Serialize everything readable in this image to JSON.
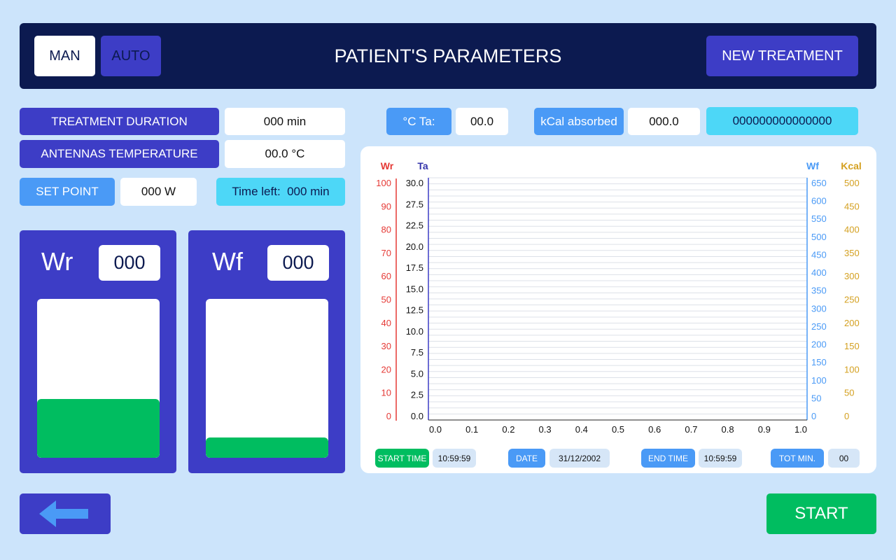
{
  "header": {
    "man_label": "MAN",
    "auto_label": "AUTO",
    "title": "PATIENT'S PARAMETERS",
    "new_treatment_label": "NEW TREATMENT"
  },
  "params": {
    "treatment_duration_label": "TREATMENT DURATION",
    "treatment_duration_value": "000 min",
    "antennas_temperature_label": "ANTENNAS TEMPERATURE",
    "antennas_temperature_value": "00.0 °C",
    "set_point_label": "SET POINT",
    "set_point_value": "000 W",
    "time_left_label": "Time left:  000 min"
  },
  "top_stats": {
    "ta_label": "°C Ta:",
    "ta_value": "00.0",
    "kcal_label": "kCal absorbed",
    "kcal_value": "000.0",
    "code": "000000000000000"
  },
  "gauges": {
    "wr": {
      "label": "Wr",
      "value": "000",
      "level": 0.37
    },
    "wf": {
      "label": "Wf",
      "value": "000",
      "level": 0.13
    }
  },
  "chart_data": {
    "type": "line",
    "axes": {
      "wr": {
        "title": "Wr",
        "color": "#e53935",
        "ticks": [
          "100",
          "90",
          "80",
          "70",
          "60",
          "50",
          "40",
          "30",
          "20",
          "10",
          "0"
        ]
      },
      "ta": {
        "title": "Ta",
        "color": "#3333aa",
        "ticks": [
          "30.0",
          "27.5",
          "22.5",
          "20.0",
          "17.5",
          "15.0",
          "12.5",
          "10.0",
          "7.5",
          "5.0",
          "2.5",
          "0.0"
        ]
      },
      "wf": {
        "title": "Wf",
        "color": "#4a9af6",
        "ticks": [
          "650",
          "600",
          "550",
          "500",
          "450",
          "400",
          "350",
          "300",
          "250",
          "200",
          "150",
          "100",
          "50",
          "0"
        ]
      },
      "kcal": {
        "title": "Kcal",
        "color": "#d4a020",
        "ticks": [
          "500",
          "450",
          "400",
          "350",
          "300",
          "250",
          "200",
          "150",
          "100",
          "50",
          "0"
        ]
      },
      "x": {
        "ticks": [
          "0.0",
          "0.1",
          "0.2",
          "0.3",
          "0.4",
          "0.5",
          "0.6",
          "0.7",
          "0.8",
          "0.9",
          "1.0"
        ]
      }
    },
    "series": []
  },
  "footer": {
    "start_time_label": "START TIME",
    "start_time_value": "10:59:59",
    "date_label": "DATE",
    "date_value": "31/12/2002",
    "end_time_label": "END TIME",
    "end_time_value": "10:59:59",
    "tot_min_label": "TOT MIN.",
    "tot_min_value": "00"
  },
  "actions": {
    "start_label": "START",
    "back_icon": "arrow-left-icon"
  },
  "colors": {
    "accent": "#3d3dc6",
    "header_bg": "#0c1a50",
    "green": "#00bd60",
    "cyan": "#4dd7f7",
    "blue": "#4a9af6"
  }
}
